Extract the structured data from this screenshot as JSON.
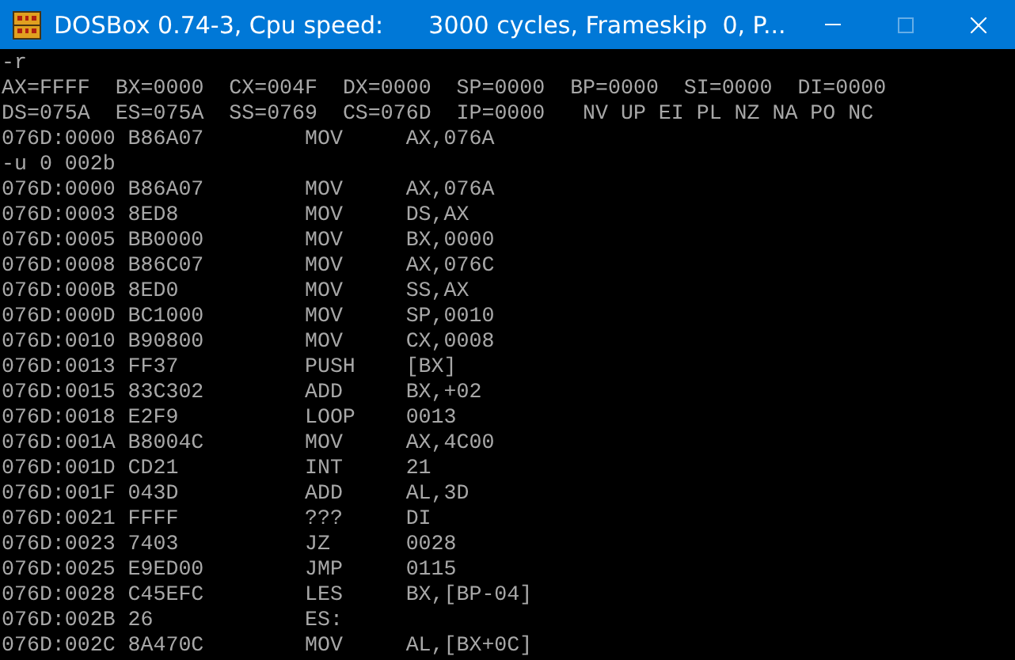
{
  "window": {
    "title": "DOSBox 0.74-3, Cpu speed:      3000 cycles, Frameskip  0, P...",
    "controls": [
      {
        "kind": "minimize",
        "disabled": false
      },
      {
        "kind": "maximize",
        "disabled": true
      },
      {
        "kind": "close",
        "disabled": false
      }
    ]
  },
  "console": {
    "lines": [
      {
        "kind": "text",
        "text": "-r"
      },
      {
        "kind": "text",
        "text": "AX=FFFF  BX=0000  CX=004F  DX=0000  SP=0000  BP=0000  SI=0000  DI=0000"
      },
      {
        "kind": "text",
        "text": "DS=075A  ES=075A  SS=0769  CS=076D  IP=0000   NV UP EI PL NZ NA PO NC"
      },
      {
        "kind": "disasm",
        "address": "076D:0000",
        "bytes": "B86A07",
        "mnemonic": "MOV",
        "operand": "AX,076A"
      },
      {
        "kind": "text",
        "text": "-u 0 002b"
      },
      {
        "kind": "disasm",
        "address": "076D:0000",
        "bytes": "B86A07",
        "mnemonic": "MOV",
        "operand": "AX,076A"
      },
      {
        "kind": "disasm",
        "address": "076D:0003",
        "bytes": "8ED8",
        "mnemonic": "MOV",
        "operand": "DS,AX"
      },
      {
        "kind": "disasm",
        "address": "076D:0005",
        "bytes": "BB0000",
        "mnemonic": "MOV",
        "operand": "BX,0000"
      },
      {
        "kind": "disasm",
        "address": "076D:0008",
        "bytes": "B86C07",
        "mnemonic": "MOV",
        "operand": "AX,076C"
      },
      {
        "kind": "disasm",
        "address": "076D:000B",
        "bytes": "8ED0",
        "mnemonic": "MOV",
        "operand": "SS,AX"
      },
      {
        "kind": "disasm",
        "address": "076D:000D",
        "bytes": "BC1000",
        "mnemonic": "MOV",
        "operand": "SP,0010"
      },
      {
        "kind": "disasm",
        "address": "076D:0010",
        "bytes": "B90800",
        "mnemonic": "MOV",
        "operand": "CX,0008"
      },
      {
        "kind": "disasm",
        "address": "076D:0013",
        "bytes": "FF37",
        "mnemonic": "PUSH",
        "operand": "[BX]"
      },
      {
        "kind": "disasm",
        "address": "076D:0015",
        "bytes": "83C302",
        "mnemonic": "ADD",
        "operand": "BX,+02"
      },
      {
        "kind": "disasm",
        "address": "076D:0018",
        "bytes": "E2F9",
        "mnemonic": "LOOP",
        "operand": "0013"
      },
      {
        "kind": "disasm",
        "address": "076D:001A",
        "bytes": "B8004C",
        "mnemonic": "MOV",
        "operand": "AX,4C00"
      },
      {
        "kind": "disasm",
        "address": "076D:001D",
        "bytes": "CD21",
        "mnemonic": "INT",
        "operand": "21"
      },
      {
        "kind": "disasm",
        "address": "076D:001F",
        "bytes": "043D",
        "mnemonic": "ADD",
        "operand": "AL,3D"
      },
      {
        "kind": "disasm",
        "address": "076D:0021",
        "bytes": "FFFF",
        "mnemonic": "???",
        "operand": "DI"
      },
      {
        "kind": "disasm",
        "address": "076D:0023",
        "bytes": "7403",
        "mnemonic": "JZ",
        "operand": "0028"
      },
      {
        "kind": "disasm",
        "address": "076D:0025",
        "bytes": "E9ED00",
        "mnemonic": "JMP",
        "operand": "0115"
      },
      {
        "kind": "disasm",
        "address": "076D:0028",
        "bytes": "C45EFC",
        "mnemonic": "LES",
        "operand": "BX,[BP-04]"
      },
      {
        "kind": "disasm",
        "address": "076D:002B",
        "bytes": "26",
        "mnemonic": "ES:"
      },
      {
        "kind": "disasm",
        "address": "076D:002C",
        "bytes": "8A470C",
        "mnemonic": "MOV",
        "operand": "AL,[BX+0C]"
      }
    ]
  }
}
